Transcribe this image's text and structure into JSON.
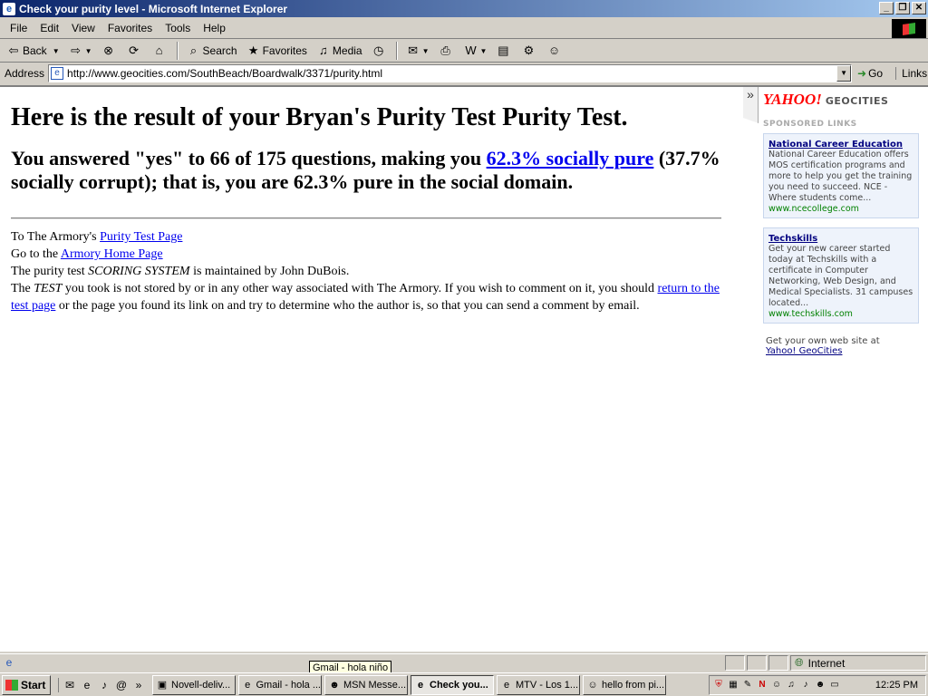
{
  "window": {
    "title": "Check your purity level - Microsoft Internet Explorer"
  },
  "menu": [
    "File",
    "Edit",
    "View",
    "Favorites",
    "Tools",
    "Help"
  ],
  "toolbar": {
    "back": "Back",
    "search": "Search",
    "favorites": "Favorites",
    "media": "Media"
  },
  "address": {
    "label": "Address",
    "url": "http://www.geocities.com/SouthBeach/Boardwalk/3371/purity.html",
    "go": "Go",
    "links": "Links"
  },
  "page": {
    "heading": "Here is the result of your Bryan's Purity Test Purity Test.",
    "result_pre": "You answered \"yes\" to 66 of 175 questions, making you ",
    "result_link": "62.3% socially pure",
    "result_post": " (37.7% socially corrupt); that is, you are 62.3% pure in the social domain.",
    "footer": {
      "line1_pre": "To The Armory's ",
      "line1_link": "Purity Test Page",
      "line2_pre": "Go to the ",
      "line2_link": "Armory Home Page",
      "line3_pre": "The purity test ",
      "line3_em": "SCORING SYSTEM",
      "line3_post": " is maintained by John DuBois.",
      "line4_pre": "The ",
      "line4_em": "TEST",
      "line4_mid": " you took is not stored by or in any other way associated with The Armory. If you wish to comment on it, you should ",
      "line4_link": "return to the test page",
      "line4_post": " or the page you found its link on and try to determine who the author is, so that you can send a comment by email."
    }
  },
  "sidebar": {
    "yahoo": "YAHOO!",
    "geocities": "GEOCITIES",
    "sponsored": "SPONSORED LINKS",
    "ads": [
      {
        "title": "National Career Education",
        "desc": "National Career Education offers MOS certification programs and more to help you get the training you need to succeed. NCE - Where students come...",
        "url": "www.ncecollege.com"
      },
      {
        "title": "Techskills",
        "desc": "Get your new career started today at Techskills with a certificate in Computer Networking, Web Design, and Medical Specialists. 31 campuses located...",
        "url": "www.techskills.com"
      }
    ],
    "getsite_text": "Get your own web site at",
    "getsite_link": "Yahoo! GeoCities"
  },
  "status": {
    "zone": "Internet",
    "tooltip": "Gmail - hola niño"
  },
  "taskbar": {
    "start": "Start",
    "tasks": [
      "Novell-deliv...",
      "Gmail - hola ...",
      "MSN Messe...",
      "Check you...",
      "MTV - Los 1...",
      "hello from pi..."
    ],
    "active_index": 3,
    "clock": "12:25 PM"
  }
}
